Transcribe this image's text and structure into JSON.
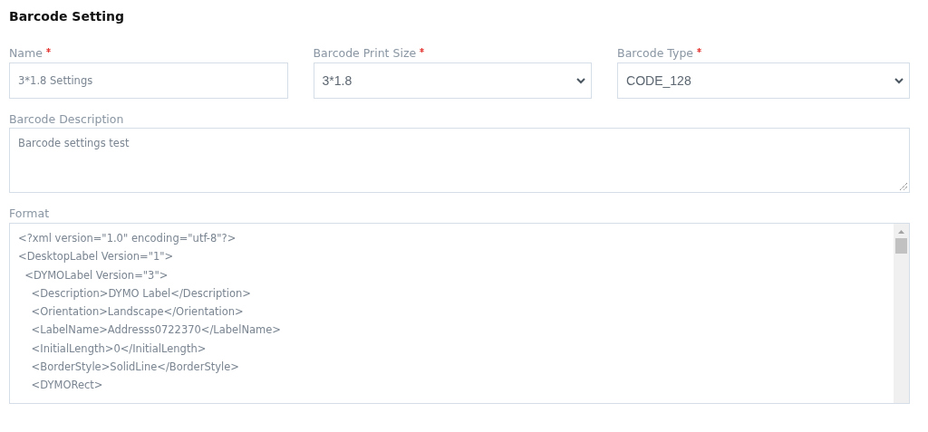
{
  "title": "Barcode Setting",
  "fields": [
    {
      "kind": "text",
      "label": "Name",
      "required": true,
      "value": "3*1.8 Settings"
    },
    {
      "kind": "select",
      "label": "Barcode Print Size",
      "required": true,
      "value": "3*1.8"
    },
    {
      "kind": "select",
      "label": "Barcode Type",
      "required": true,
      "value": "CODE_128"
    }
  ],
  "description": {
    "label": "Barcode Description",
    "value": "Barcode settings test"
  },
  "format": {
    "label": "Format",
    "lines": [
      "<?xml version=\"1.0\" encoding=\"utf-8\"?>",
      "<DesktopLabel Version=\"1\">",
      "  <DYMOLabel Version=\"3\">",
      "    <Description>DYMO Label</Description>",
      "    <Orientation>Landscape</Orientation>",
      "    <LabelName>Addresss0722370</LabelName>",
      "    <InitialLength>0</InitialLength>",
      "    <BorderStyle>SolidLine</BorderStyle>",
      "    <DYMORect>"
    ]
  }
}
